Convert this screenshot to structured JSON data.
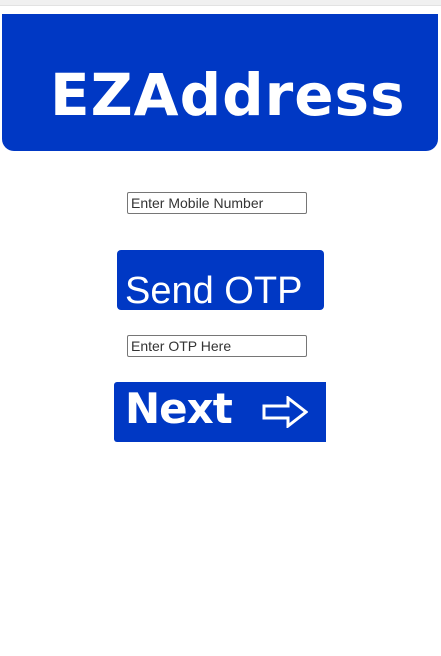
{
  "header": {
    "title": "EZAddress"
  },
  "form": {
    "mobile_placeholder": "Enter Mobile Number",
    "send_otp_label": "Send OTP",
    "otp_placeholder": "Enter OTP Here",
    "next_label": "Next",
    "next_icon": "arrow-right-icon"
  },
  "colors": {
    "brand_blue": "#0038c4",
    "text_white": "#ffffff"
  }
}
